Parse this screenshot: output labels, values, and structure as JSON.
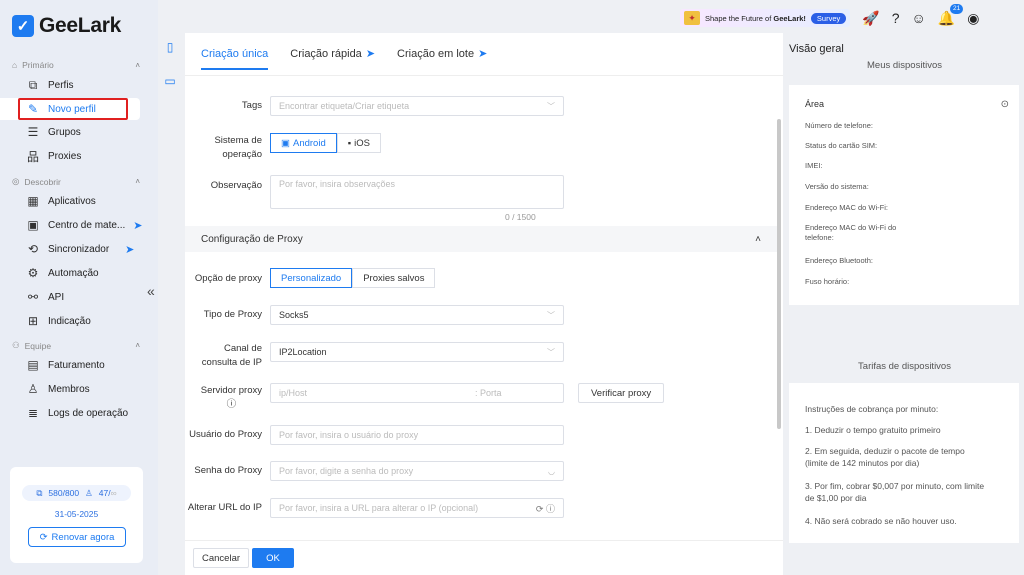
{
  "app": {
    "logo_text": "GeeLark",
    "logo_glyph": "✓"
  },
  "sidebar": {
    "sections": [
      {
        "label": "Primário"
      },
      {
        "label": "Descobrir"
      },
      {
        "label": "Equipe"
      }
    ],
    "items": [
      {
        "label": "Perfis"
      },
      {
        "label": "Novo perfil"
      },
      {
        "label": "Grupos"
      },
      {
        "label": "Proxies"
      },
      {
        "label": "Aplicativos"
      },
      {
        "label": "Centro de mate..."
      },
      {
        "label": "Sincronizador"
      },
      {
        "label": "Automação"
      },
      {
        "label": "API"
      },
      {
        "label": "Indicação"
      },
      {
        "label": "Faturamento"
      },
      {
        "label": "Membros"
      },
      {
        "label": "Logs de operação"
      }
    ],
    "plan": {
      "profiles": "580/800",
      "members": "47/",
      "members_suffix": "∞",
      "date": "31-05-2025",
      "renew_label": "Renovar agora"
    }
  },
  "topbar": {
    "banner_text_prefix": "Shape the Future of ",
    "banner_text_bold": "GeeLark!",
    "survey_label": "Survey",
    "notification_count": "21"
  },
  "tabs": [
    {
      "label": "Criação única"
    },
    {
      "label": "Criação rápida"
    },
    {
      "label": "Criação em lote"
    }
  ],
  "form": {
    "tags": {
      "label": "Tags",
      "placeholder": "Encontrar etiqueta/Criar etiqueta"
    },
    "os": {
      "label": "Sistema de operação",
      "options": [
        "Android",
        "iOS"
      ],
      "selected": "Android"
    },
    "note": {
      "label": "Observação",
      "placeholder": "Por favor, insira observações",
      "counter": "0 / 1500"
    },
    "proxy_section": {
      "title": "Configuração de Proxy"
    },
    "proxy_option": {
      "label": "Opção de proxy",
      "options": [
        "Personalizado",
        "Proxies salvos"
      ],
      "selected": "Personalizado"
    },
    "proxy_type": {
      "label": "Tipo de Proxy",
      "value": "Socks5"
    },
    "ip_channel": {
      "label": "Canal de consulta de IP",
      "value": "IP2Location"
    },
    "proxy_server": {
      "label": "Servidor proxy",
      "host_placeholder": "ip/Host",
      "port_placeholder": "Porta",
      "verify_label": "Verificar proxy"
    },
    "proxy_user": {
      "label": "Usuário do Proxy",
      "placeholder": "Por favor, insira o usuário do proxy"
    },
    "proxy_pass": {
      "label": "Senha do Proxy",
      "placeholder": "Por favor, digite a senha do proxy"
    },
    "change_ip_url": {
      "label": "Alterar URL do IP",
      "placeholder": "Por favor, insira a URL para alterar o IP (opcional)"
    }
  },
  "footer": {
    "cancel_label": "Cancelar",
    "ok_label": "OK"
  },
  "overview": {
    "title": "Visão geral",
    "subtitle": "Meus dispositivos",
    "area_label": "Área",
    "fields": [
      "Número de telefone:",
      "Status do cartão SIM:",
      "IMEI:",
      "Versão do sistema:",
      "Endereço MAC do Wi-Fi:",
      "Endereço MAC do Wi-Fi do telefone:",
      "Endereço Bluetooth:",
      "Fuso horário:"
    ],
    "tariff_title": "Tarifas de dispositivos",
    "tariff_lines": [
      "Instruções de cobrança por minuto:",
      "1. Deduzir o tempo gratuito primeiro",
      "2. Em seguida, deduzir o pacote de tempo (limite de 142 minutos por dia)",
      "3. Por fim, cobrar $0,007 por minuto, com limite de $1,00 por dia",
      "4. Não será cobrado se não houver uso."
    ]
  }
}
